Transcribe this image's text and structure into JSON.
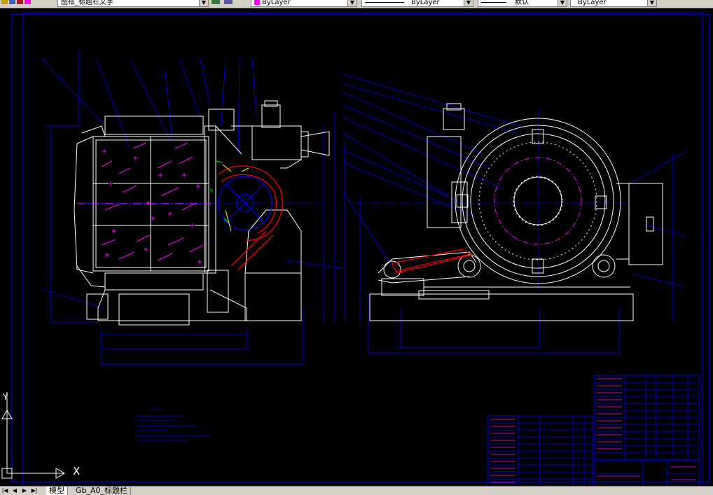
{
  "toolbar": {
    "text_style": "图框_标题栏文字",
    "layer_color": "ByLayer",
    "linetype": "ByLayer",
    "lineweight": "默认",
    "plot_style": "ByLayer",
    "layer_swatch_color": "#ff00ff"
  },
  "tabs": {
    "model": "模型",
    "layout": "Gb_A0_标题栏"
  },
  "ucs": {
    "x_label": "X",
    "y_label": "Y"
  },
  "colors": {
    "drawing_frame": "#0000ff",
    "geometry": "#ffffff",
    "accent_magenta": "#ff00ff",
    "accent_red": "#ff0000",
    "accent_yellow": "#ffff00",
    "accent_green": "#00ff00"
  }
}
